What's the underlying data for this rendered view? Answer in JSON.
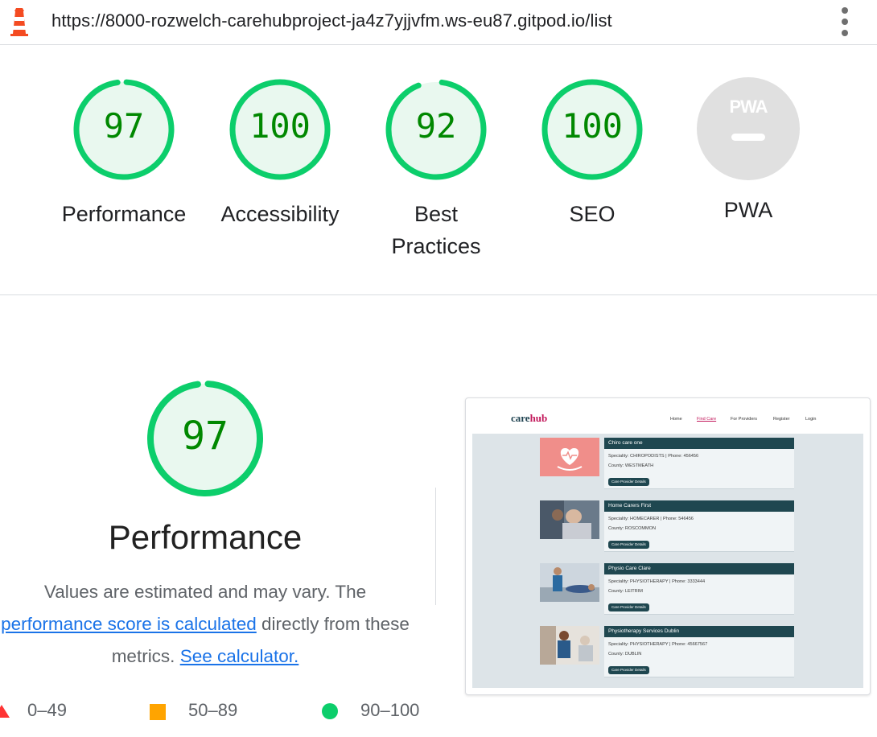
{
  "browser": {
    "url": "https://8000-rozwelch-carehubproject-ja4z7yjjvfm.ws-eu87.gitpod.io/list"
  },
  "scores": [
    {
      "value": "97",
      "label": "Performance"
    },
    {
      "value": "100",
      "label": "Accessibility"
    },
    {
      "value": "92",
      "label": "Best Practices"
    },
    {
      "value": "100",
      "label": "SEO"
    }
  ],
  "pwa": {
    "badge": "PWA",
    "label": "PWA"
  },
  "performance": {
    "score": "97",
    "title": "Performance",
    "desc_pre": "Values are estimated and may vary. The",
    "desc_link": "performance score is calculated",
    "desc_mid": "directly from these metrics.",
    "desc_link2": "See calculator."
  },
  "legend": {
    "fail": "0–49",
    "average": "50–89",
    "pass": "90–100"
  },
  "colors": {
    "pass": "#0cce6b",
    "pass_text": "#008800",
    "average": "#ffa400",
    "fail": "#ff3333",
    "link": "#1a73e8"
  },
  "thumbnail": {
    "brand_a": "care",
    "brand_b": "hub",
    "nav": [
      "Home",
      "Find Care",
      "For Providers",
      "Register",
      "Login"
    ],
    "cards": [
      {
        "title": "Chiro care one",
        "line1": "Speciality: CHIROPODISTS | Phone: 456456",
        "line2": "County: WESTMEATH",
        "button": "Care Provider Details"
      },
      {
        "title": "Home Carers First",
        "line1": "Speciality: HOMECARER | Phone: 546456",
        "line2": "County: ROSCOMMON",
        "button": "Care Provider Details"
      },
      {
        "title": "Physio Care Clare",
        "line1": "Speciality: PHYSIOTHERAPY | Phone: 3333444",
        "line2": "County: LEITRIM",
        "button": "Care Provider Details"
      },
      {
        "title": "Physiotherapy Services Dublin",
        "line1": "Speciality: PHYSIOTHERAPY | Phone: 45667567",
        "line2": "County: DUBLIN",
        "button": "Care Provider Details"
      }
    ]
  }
}
